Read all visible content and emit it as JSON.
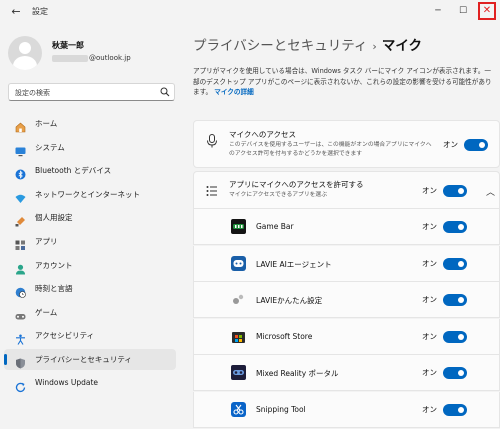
{
  "window": {
    "title": "設定",
    "back_glyph": "←",
    "minimize_glyph": "─",
    "maximize_glyph": "☐",
    "close_glyph": "✕"
  },
  "user": {
    "name": "秋葉一郎",
    "email_suffix": "@outlook.jp"
  },
  "search": {
    "placeholder": "設定の検索"
  },
  "sidebar": {
    "items": [
      {
        "label": "ホーム",
        "icon": "home-icon"
      },
      {
        "label": "システム",
        "icon": "monitor-icon"
      },
      {
        "label": "Bluetooth とデバイス",
        "icon": "bluetooth-icon"
      },
      {
        "label": "ネットワークとインターネット",
        "icon": "wifi-icon"
      },
      {
        "label": "個人用設定",
        "icon": "brush-icon"
      },
      {
        "label": "アプリ",
        "icon": "apps-icon"
      },
      {
        "label": "アカウント",
        "icon": "account-icon"
      },
      {
        "label": "時刻と言語",
        "icon": "globe-clock-icon"
      },
      {
        "label": "ゲーム",
        "icon": "game-icon"
      },
      {
        "label": "アクセシビリティ",
        "icon": "accessibility-icon"
      },
      {
        "label": "プライバシーとセキュリティ",
        "icon": "shield-icon",
        "active": true
      },
      {
        "label": "Windows Update",
        "icon": "update-icon"
      }
    ]
  },
  "main": {
    "breadcrumb_parent": "プライバシーとセキュリティ",
    "breadcrumb_sep": "›",
    "breadcrumb_current": "マイク",
    "description": "アプリがマイクを使用している場合は、Windows タスク バーにマイク アイコンが表示されます。一部のデスクトップ アプリがこのページに表示されないか、これらの設定の影響を受ける可能性があります。",
    "description_link": "マイクの詳細",
    "mic_access": {
      "title": "マイクへのアクセス",
      "subtitle": "このデバイスを使用するユーザーは、この機能がオンの場合アプリにマイクへのアクセス許可を付与するかどうかを選択できます",
      "toggle_label": "オン",
      "icon": "microphone-icon"
    },
    "app_access": {
      "title": "アプリにマイクへのアクセスを許可する",
      "subtitle": "マイクにアクセスできるアプリを選ぶ",
      "toggle_label": "オン",
      "icon": "app-list-icon",
      "chevron": "︿"
    },
    "apps": [
      {
        "name": "Game Bar",
        "toggle_label": "オン",
        "icon": "game-bar-icon",
        "color": "#1f8f3a"
      },
      {
        "name": "LAVIE AIエージェント",
        "toggle_label": "オン",
        "icon": "lavie-ai-icon",
        "color": "#1a5fa8"
      },
      {
        "name": "LAVIEかんたん設定",
        "toggle_label": "オン",
        "icon": "lavie-settings-icon",
        "color": "#888888"
      },
      {
        "name": "Microsoft Store",
        "toggle_label": "オン",
        "icon": "store-icon",
        "color": "#2b2b2b"
      },
      {
        "name": "Mixed Reality ポータル",
        "toggle_label": "オン",
        "icon": "mixed-reality-icon",
        "color": "#1d1d3a"
      },
      {
        "name": "Snipping Tool",
        "toggle_label": "オン",
        "icon": "snipping-tool-icon",
        "color": "#0a64c8"
      }
    ]
  },
  "colors": {
    "accent": "#0067c0",
    "close_highlight": "#e02020"
  }
}
